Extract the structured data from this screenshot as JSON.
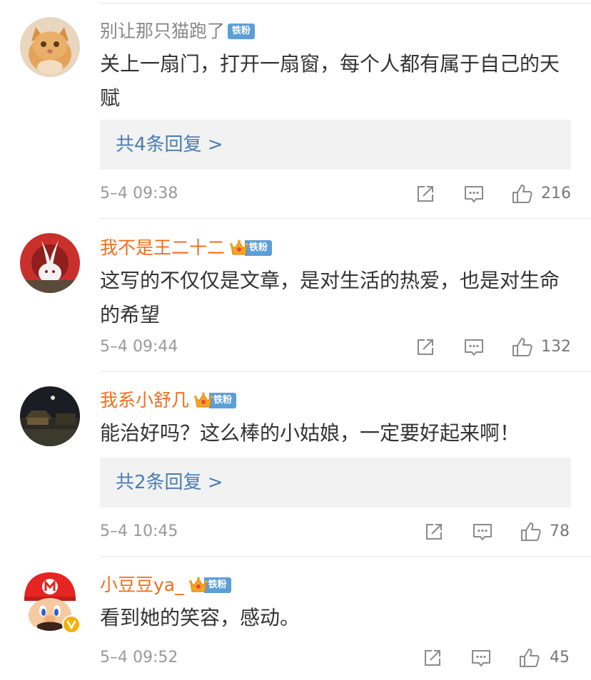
{
  "comments": [
    {
      "author": "别让那只猫跑了",
      "fan_badge": "铁粉",
      "text": "关上一扇门，打开一扇窗，每个人都有属于自己的天赋",
      "replies": "共4条回复 >",
      "time": "5–4 09:38",
      "likes": "216"
    },
    {
      "author": "我不是王二十二",
      "fan_badge": "铁粉",
      "text": "这写的不仅仅是文章，是对生活的热爱，也是对生命的希望",
      "time": "5–4 09:44",
      "likes": "132"
    },
    {
      "author": "我系小舒几",
      "fan_badge": "铁粉",
      "text": "能治好吗？这么棒的小姑娘，一定要好起来啊！",
      "replies": "共2条回复 >",
      "time": "5–4 10:45",
      "likes": "78"
    },
    {
      "author": "小豆豆ya_",
      "fan_badge": "铁粉",
      "text": "看到她的笑容，感动。",
      "time": "5–4 09:52",
      "likes": "45"
    }
  ],
  "icons": {
    "share": "share-icon",
    "comment": "comment-icon",
    "like": "thumbs-up-icon",
    "crown": "crown-icon",
    "verified": "verified-v-icon"
  },
  "colors": {
    "name_plain": "#888888",
    "name_highlight": "#f26d1c",
    "fan_badge_bg": "#5c9ed8",
    "reply_link": "#4a7db5",
    "reply_bg": "#f2f2f2",
    "timestamp": "#999999",
    "verified_badge": "#f4b10b"
  }
}
